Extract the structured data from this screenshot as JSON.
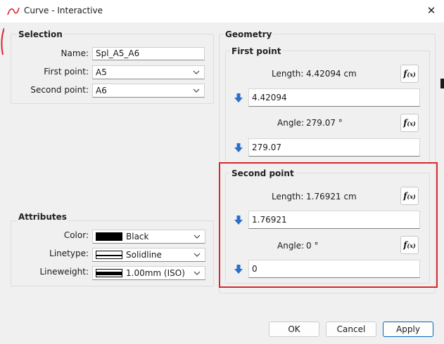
{
  "window": {
    "title": "Curve - Interactive",
    "close_glyph": "✕"
  },
  "selection": {
    "title": "Selection",
    "name_label": "Name:",
    "name_value": "Spl_A5_A6",
    "first_point_label": "First point:",
    "first_point_value": "A5",
    "second_point_label": "Second point:",
    "second_point_value": "A6"
  },
  "attributes": {
    "title": "Attributes",
    "color_label": "Color:",
    "color_value": "Black",
    "linetype_label": "Linetype:",
    "linetype_value": "Solidline",
    "lineweight_label": "Lineweight:",
    "lineweight_value": "1.00mm (ISO)"
  },
  "geometry": {
    "title": "Geometry",
    "first_point": {
      "title": "First point",
      "length_label": "Length:",
      "length_value": "4.42094 cm",
      "length_input": "4.42094",
      "angle_label": "Angle:",
      "angle_value": "279.07 °",
      "angle_input": "279.07"
    },
    "second_point": {
      "title": "Second point",
      "length_label": "Length:",
      "length_value": "1.76921 cm",
      "length_input": "1.76921",
      "angle_label": "Angle:",
      "angle_value": "0 °",
      "angle_input": "0"
    }
  },
  "fx_label": {
    "main": "f",
    "sub": "(x)"
  },
  "buttons": {
    "ok": "OK",
    "cancel": "Cancel",
    "apply": "Apply"
  },
  "colors": {
    "highlight": "#d9272e",
    "accent": "#0067c0",
    "arrow": "#2a6fc9"
  },
  "icons": [
    "curve-app-icon",
    "close-icon",
    "chevron-down-icon",
    "down-arrow-icon",
    "function-icon"
  ]
}
